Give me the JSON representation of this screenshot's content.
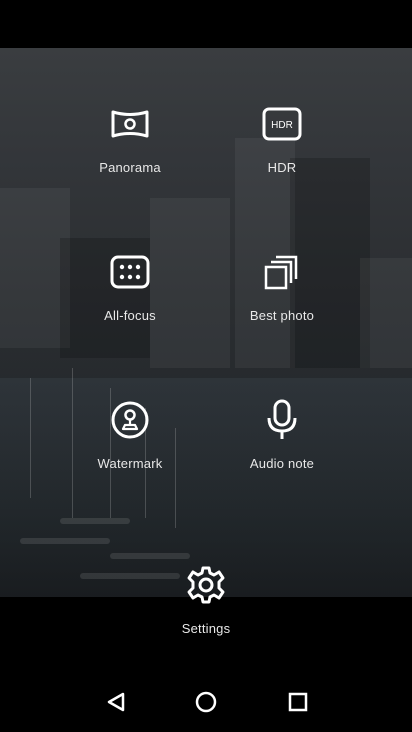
{
  "modes": [
    {
      "label": "Panorama",
      "icon": "panorama-icon"
    },
    {
      "label": "HDR",
      "icon": "hdr-icon",
      "icon_text": "HDR"
    },
    {
      "label": "All-focus",
      "icon": "all-focus-icon"
    },
    {
      "label": "Best photo",
      "icon": "best-photo-icon"
    },
    {
      "label": "Watermark",
      "icon": "watermark-icon"
    },
    {
      "label": "Audio note",
      "icon": "microphone-icon"
    }
  ],
  "settings": {
    "label": "Settings",
    "icon": "gear-icon"
  },
  "nav": {
    "back_icon": "back-triangle-icon",
    "home_icon": "home-circle-icon",
    "recents_icon": "recents-square-icon"
  },
  "colors": {
    "label_text": "#e8e8e8",
    "icon_stroke": "#ffffff",
    "bar_background": "#000000"
  }
}
